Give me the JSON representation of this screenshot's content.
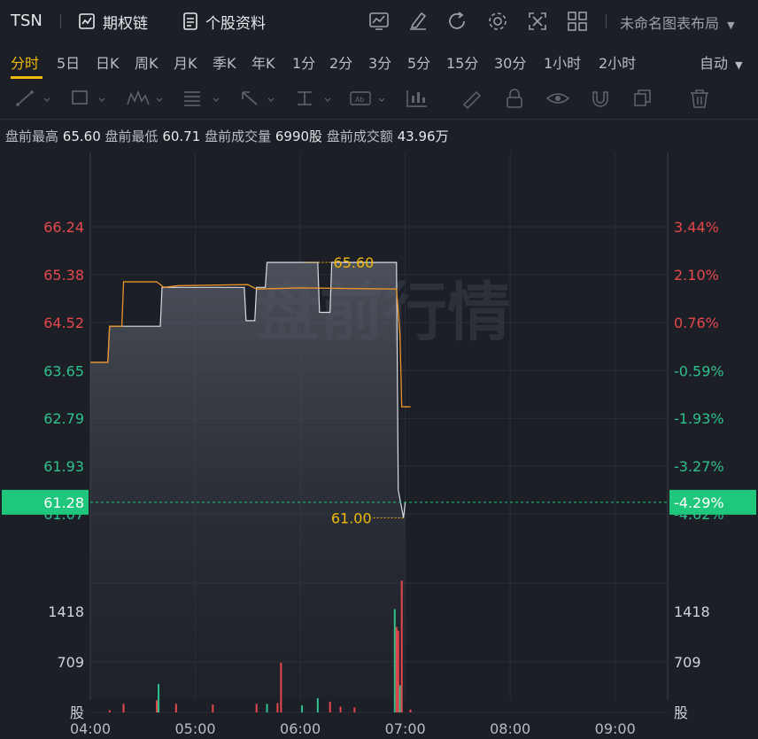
{
  "header": {
    "symbol": "TSN",
    "options_chain_label": "期权链",
    "profile_label": "个股资料",
    "layout_label": "未命名图表布局",
    "icons": [
      "chart-type-icon",
      "draw-icon",
      "refresh-icon",
      "settings-icon",
      "fullscreen-icon",
      "grid-layout-icon"
    ]
  },
  "tabs": [
    "分时",
    "5日",
    "日K",
    "周K",
    "月K",
    "季K",
    "年K",
    "1分",
    "2分",
    "3分",
    "5分",
    "15分",
    "30分",
    "1小时",
    "2小时"
  ],
  "active_tab": "分时",
  "auto_label": "自动",
  "premarket": {
    "high_label": "盘前最高",
    "high": "65.60",
    "low_label": "盘前最低",
    "low": "60.71",
    "volume_label": "盘前成交量",
    "volume": "6990股",
    "amount_label": "盘前成交额",
    "amount": "43.96万"
  },
  "colors": {
    "up": "#e5484d",
    "down": "#2fc08c",
    "accent": "#f0b90b",
    "current": "#1fc77c",
    "avg_line": "#e8942b"
  },
  "chart_data": {
    "type": "line",
    "watermark": "盘前行情",
    "price_axis": {
      "left_labels": [
        "66.24",
        "65.38",
        "64.52",
        "63.65",
        "62.79",
        "61.93",
        "61.07"
      ],
      "right_labels": [
        "3.44%",
        "2.10%",
        "0.76%",
        "-0.59%",
        "-1.93%",
        "-3.27%",
        "-4.62%"
      ],
      "ylim": [
        61.07,
        66.24
      ],
      "prev_close": 64.04
    },
    "current_price": "61.28",
    "current_change": "-4.29%",
    "high_marker": "65.60",
    "low_marker": "61.00",
    "x_labels": [
      "04:00",
      "05:00",
      "06:00",
      "07:00",
      "08:00",
      "09:00"
    ],
    "price_series": [
      [
        "04:00",
        63.8
      ],
      [
        "04:10",
        63.8
      ],
      [
        "04:11",
        64.45
      ],
      [
        "04:40",
        64.45
      ],
      [
        "04:41",
        65.15
      ],
      [
        "05:28",
        65.15
      ],
      [
        "05:29",
        64.55
      ],
      [
        "05:34",
        64.55
      ],
      [
        "05:35",
        65.15
      ],
      [
        "05:40",
        65.15
      ],
      [
        "05:41",
        65.6
      ],
      [
        "06:10",
        65.6
      ],
      [
        "06:11",
        64.7
      ],
      [
        "06:17",
        64.7
      ],
      [
        "06:18",
        65.6
      ],
      [
        "06:55",
        65.6
      ],
      [
        "06:56",
        61.5
      ],
      [
        "06:59",
        61.0
      ],
      [
        "07:00",
        61.28
      ]
    ],
    "avg_series": [
      [
        "04:00",
        63.8
      ],
      [
        "04:10",
        63.8
      ],
      [
        "04:11",
        64.45
      ],
      [
        "04:18",
        64.45
      ],
      [
        "04:19",
        65.25
      ],
      [
        "04:38",
        65.25
      ],
      [
        "04:42",
        65.15
      ],
      [
        "04:50",
        65.18
      ],
      [
        "05:30",
        65.2
      ],
      [
        "05:35",
        65.12
      ],
      [
        "06:00",
        65.14
      ],
      [
        "06:55",
        65.12
      ],
      [
        "06:57",
        64.3
      ],
      [
        "06:58",
        63.0
      ],
      [
        "07:03",
        63.0
      ]
    ],
    "volume_axis": {
      "labels": [
        "1418",
        "709",
        "股"
      ],
      "max": 2127
    },
    "volume_bars": [
      {
        "t": "04:11",
        "v": 30,
        "up": true
      },
      {
        "t": "04:19",
        "v": 120,
        "up": true
      },
      {
        "t": "04:38",
        "v": 170,
        "up": true
      },
      {
        "t": "04:39",
        "v": 400,
        "up": false
      },
      {
        "t": "04:49",
        "v": 120,
        "up": true
      },
      {
        "t": "05:10",
        "v": 110,
        "up": true
      },
      {
        "t": "05:35",
        "v": 120,
        "up": true
      },
      {
        "t": "05:41",
        "v": 120,
        "up": false
      },
      {
        "t": "05:47",
        "v": 130,
        "up": true
      },
      {
        "t": "05:49",
        "v": 700,
        "up": true
      },
      {
        "t": "06:01",
        "v": 100,
        "up": false
      },
      {
        "t": "06:10",
        "v": 200,
        "up": false
      },
      {
        "t": "06:17",
        "v": 150,
        "up": true
      },
      {
        "t": "06:23",
        "v": 80,
        "up": true
      },
      {
        "t": "06:31",
        "v": 70,
        "up": true
      },
      {
        "t": "06:54",
        "v": 1450,
        "up": false
      },
      {
        "t": "06:55",
        "v": 1200,
        "up": true
      },
      {
        "t": "06:56",
        "v": 1150,
        "up": true
      },
      {
        "t": "06:57",
        "v": 380,
        "up": false
      },
      {
        "t": "06:58",
        "v": 1850,
        "up": true
      },
      {
        "t": "07:03",
        "v": 40,
        "up": true
      }
    ]
  }
}
